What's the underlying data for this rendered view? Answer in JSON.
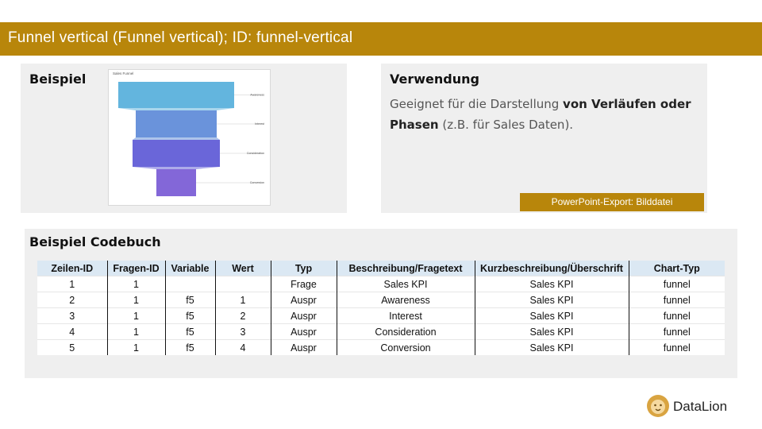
{
  "header": {
    "title": "Funnel vertical (Funnel vertical); ID: funnel-vertical"
  },
  "example": {
    "label": "Beispiel",
    "chart_title": "Sales Funnel"
  },
  "chart_data": {
    "type": "funnel",
    "title": "Sales Funnel",
    "categories": [
      "Awareness",
      "Interest",
      "Consideration",
      "Conversion"
    ],
    "colors": [
      "#63b5de",
      "#6a93db",
      "#6a66d9",
      "#8367d8"
    ]
  },
  "usage": {
    "label": "Verwendung",
    "text_part1": "Geeignet für die Darstellung ",
    "text_bold": "von Verläufen oder Phasen",
    "text_part2": " (z.B. für Sales Daten).",
    "export_badge": "PowerPoint-Export: Bilddatei"
  },
  "codebook": {
    "label": "Beispiel Codebuch",
    "headers": [
      "Zeilen-ID",
      "Fragen-ID",
      "Variable",
      "Wert",
      "Typ",
      "Beschreibung/Fragetext",
      "Kurzbeschreibung/Überschrift",
      "Chart-Typ"
    ],
    "rows": [
      [
        "1",
        "1",
        "",
        "",
        "Frage",
        "Sales KPI",
        "Sales KPI",
        "funnel"
      ],
      [
        "2",
        "1",
        "f5",
        "1",
        "Auspr",
        "Awareness",
        "Sales KPI",
        "funnel"
      ],
      [
        "3",
        "1",
        "f5",
        "2",
        "Auspr",
        "Interest",
        "Sales KPI",
        "funnel"
      ],
      [
        "4",
        "1",
        "f5",
        "3",
        "Auspr",
        "Consideration",
        "Sales KPI",
        "funnel"
      ],
      [
        "5",
        "1",
        "f5",
        "4",
        "Auspr",
        "Conversion",
        "Sales KPI",
        "funnel"
      ]
    ]
  },
  "logo": {
    "text": "DataLion",
    "icon": "lion-icon"
  }
}
